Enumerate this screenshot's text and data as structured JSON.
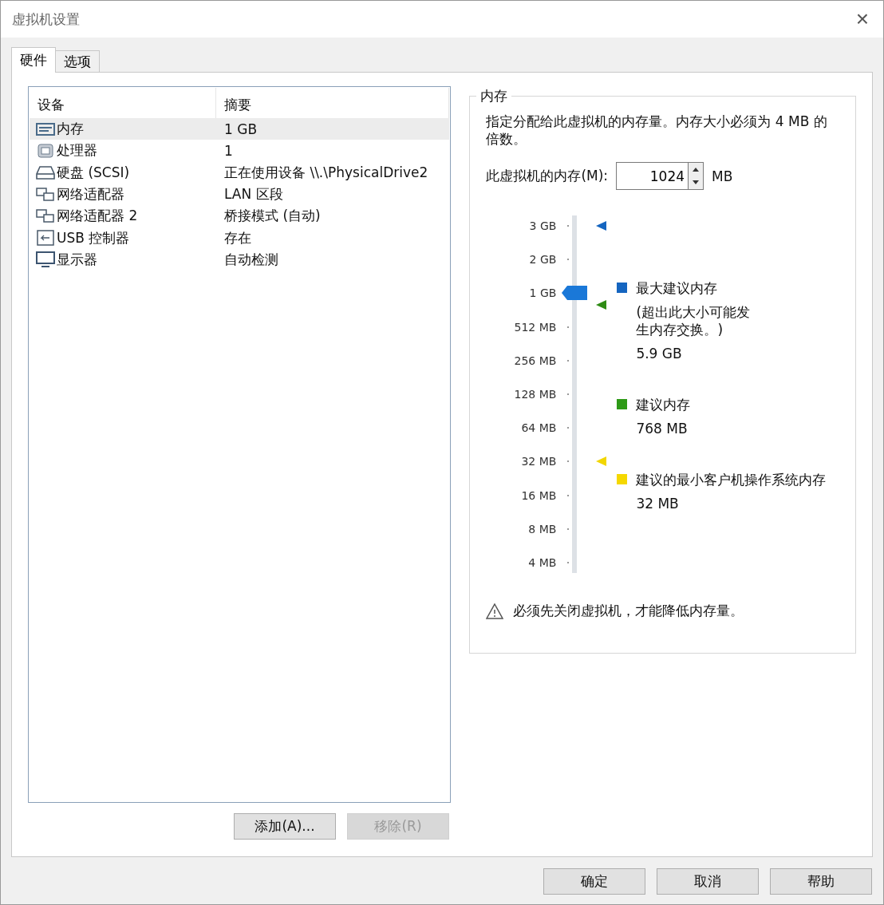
{
  "window": {
    "title": "虚拟机设置",
    "close": "×"
  },
  "tabs": [
    {
      "label": "硬件",
      "selected": true
    },
    {
      "label": "选项",
      "selected": false
    }
  ],
  "device_table": {
    "columns": [
      "设备",
      "摘要"
    ],
    "rows": [
      {
        "kind": "memory",
        "device": "内存",
        "summary": "1 GB",
        "selected": true
      },
      {
        "kind": "cpu",
        "device": "处理器",
        "summary": "1",
        "selected": false
      },
      {
        "kind": "disk",
        "device": "硬盘 (SCSI)",
        "summary": "正在使用设备 \\\\.\\PhysicalDrive2",
        "selected": false
      },
      {
        "kind": "network",
        "device": "网络适配器",
        "summary": "LAN 区段",
        "selected": false
      },
      {
        "kind": "network",
        "device": "网络适配器 2",
        "summary": "桥接模式 (自动)",
        "selected": false
      },
      {
        "kind": "usb",
        "device": "USB 控制器",
        "summary": "存在",
        "selected": false
      },
      {
        "kind": "display",
        "device": "显示器",
        "summary": "自动检测",
        "selected": false
      }
    ]
  },
  "device_buttons": [
    {
      "label": "添加(A)...",
      "disabled": false
    },
    {
      "label": "移除(R)",
      "disabled": true
    }
  ],
  "memory": {
    "title": "内存",
    "description": "指定分配给此虚拟机的内存量。内存大小必须为 4 MB 的倍数。",
    "field_label": "此虚拟机的内存(M):",
    "value": "1024",
    "unit": "MB",
    "slider": {
      "level": 0.8,
      "ticks": [
        "3 GB",
        "2 GB",
        "1 GB",
        "512 MB",
        "256 MB",
        "128 MB",
        "64 MB",
        "32 MB",
        "16 MB",
        "8 MB",
        "4 MB"
      ]
    },
    "markers": [
      {
        "color": "#1565c0"
      },
      {
        "color": "#2e8b14"
      },
      {
        "color": "#f2d600"
      }
    ],
    "legend": [
      {
        "color": "#1565c0",
        "title": "最大建议内存",
        "note": "(超出此大小可能发生内存交换。)",
        "value": "5.9 GB"
      },
      {
        "color": "#2e9a17",
        "title": "建议内存",
        "value": "768 MB"
      },
      {
        "color": "#f5d800",
        "title": "建议的最小客户机操作系统内存",
        "value": "32 MB"
      }
    ],
    "warning": "必须先关闭虚拟机，才能降低内存量。"
  },
  "dialog_buttons": [
    "确定",
    "取消",
    "帮助"
  ]
}
